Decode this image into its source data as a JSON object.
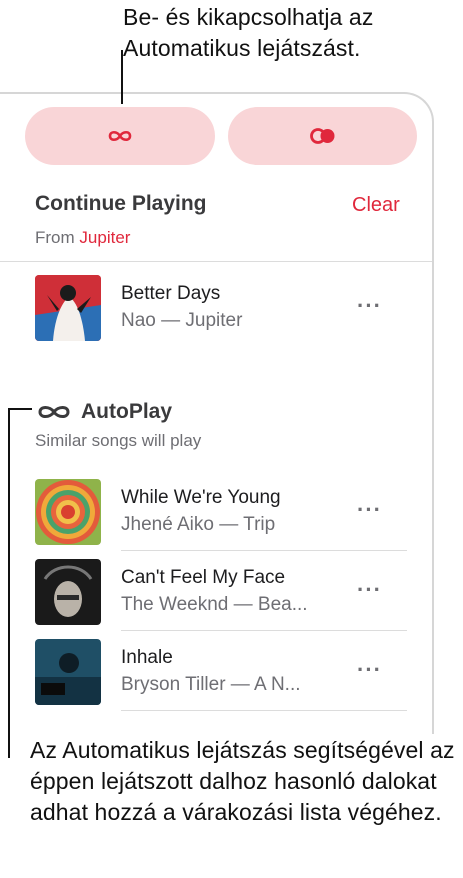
{
  "callouts": {
    "top": "Be- és kikapcsolhatja az Automatikus lejátszást.",
    "bottom": "Az Automatikus lejátszás segítségével az éppen lejátszott dalhoz hasonló dalokat adhat hozzá a várakozási lista végéhez."
  },
  "controls": {
    "autoplay_icon": "infinity-icon",
    "repeat_icon": "repeat-circles-icon",
    "accent_color": "#e0283c",
    "button_bg": "#f9d5d7"
  },
  "continue_playing": {
    "title": "Continue Playing",
    "clear_label": "Clear",
    "from_prefix": "From",
    "from_source": "Jupiter",
    "songs": [
      {
        "title": "Better Days",
        "subtitle": "Nao — Jupiter"
      }
    ]
  },
  "autoplay": {
    "title": "AutoPlay",
    "subtitle": "Similar songs will play",
    "songs": [
      {
        "title": "While We're Young",
        "subtitle": "Jhené Aiko — Trip"
      },
      {
        "title": "Can't Feel My Face",
        "subtitle": "The Weeknd — Bea..."
      },
      {
        "title": "Inhale",
        "subtitle": "Bryson Tiller — A N..."
      }
    ]
  },
  "more_label": "···"
}
